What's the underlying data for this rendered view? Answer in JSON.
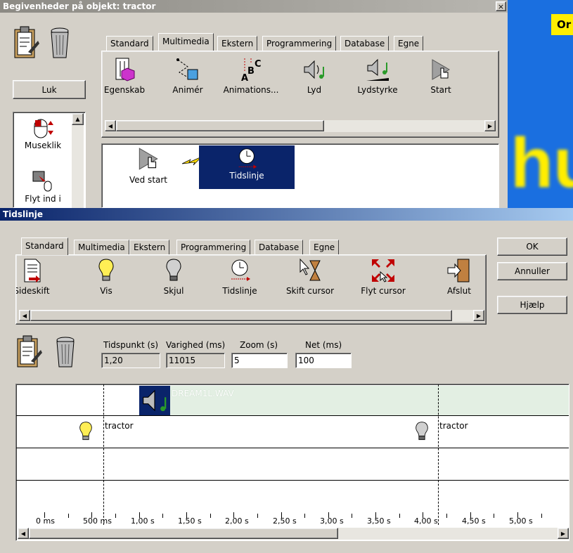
{
  "top_window": {
    "title": "Begivenheder på objekt: tractor",
    "close_button": "×",
    "luk_button": "Luk",
    "tabs": [
      {
        "label": "Standard"
      },
      {
        "label": "Multimedia"
      },
      {
        "label": "Ekstern"
      },
      {
        "label": "Programmering"
      },
      {
        "label": "Database"
      },
      {
        "label": "Egne"
      }
    ],
    "actions": [
      {
        "label": "Egenskab",
        "icon": "property-icon"
      },
      {
        "label": "Animér",
        "icon": "animate-icon"
      },
      {
        "label": "Animations...",
        "icon": "abc-animation-icon"
      },
      {
        "label": "Lyd",
        "icon": "sound-icon"
      },
      {
        "label": "Lydstyrke",
        "icon": "volume-icon"
      },
      {
        "label": "Start",
        "icon": "start-icon"
      }
    ],
    "events": [
      {
        "label": "Museklik",
        "icon": "mouse-click-icon"
      },
      {
        "label": "Flyt ind i",
        "icon": "move-into-icon"
      }
    ],
    "sequence": [
      {
        "label": "Ved start",
        "icon": "start-icon"
      },
      {
        "label": "Tidslinje",
        "icon": "timeline-icon"
      }
    ]
  },
  "background_panel": {
    "text_top": "Or",
    "text_big": "hu",
    "bg_color": "#1a6fe0",
    "text_color": "#ffee00"
  },
  "bottom_window": {
    "title": "Tidslinje",
    "ok_button": "OK",
    "cancel_button": "Annuller",
    "help_button": "Hjælp",
    "tabs": [
      {
        "label": "Standard"
      },
      {
        "label": "Multimedia"
      },
      {
        "label": "Ekstern"
      },
      {
        "label": "Programmering"
      },
      {
        "label": "Database"
      },
      {
        "label": "Egne"
      }
    ],
    "actions": [
      {
        "label": "Sideskift",
        "icon": "page-break-icon"
      },
      {
        "label": "Vis",
        "icon": "bulb-on-icon"
      },
      {
        "label": "Skjul",
        "icon": "bulb-off-icon"
      },
      {
        "label": "Tidslinje",
        "icon": "timeline-icon"
      },
      {
        "label": "Skift cursor",
        "icon": "hourglass-cursor-icon"
      },
      {
        "label": "Flyt cursor",
        "icon": "move-cursor-icon"
      },
      {
        "label": "Afslut",
        "icon": "exit-icon"
      }
    ],
    "fields": {
      "tidspunkt_label": "Tidspunkt (s)",
      "tidspunkt_value": "1,20",
      "varighed_label": "Varighed (ms)",
      "varighed_value": "11015",
      "zoom_label": "Zoom (s)",
      "zoom_value": "5",
      "net_label": "Net (ms)",
      "net_value": "100"
    },
    "timeline": {
      "sound_clip_label": "DREAM1L.WAV",
      "show_event_label": "tractor",
      "hide_event_label": "tractor",
      "ticks": [
        "0 ms",
        "500 ms",
        "1,00 s",
        "1,50 s",
        "2,00 s",
        "2,50 s",
        "3,00 s",
        "3,50 s",
        "4,00 s",
        "4,50 s",
        "5,00 s"
      ]
    }
  }
}
